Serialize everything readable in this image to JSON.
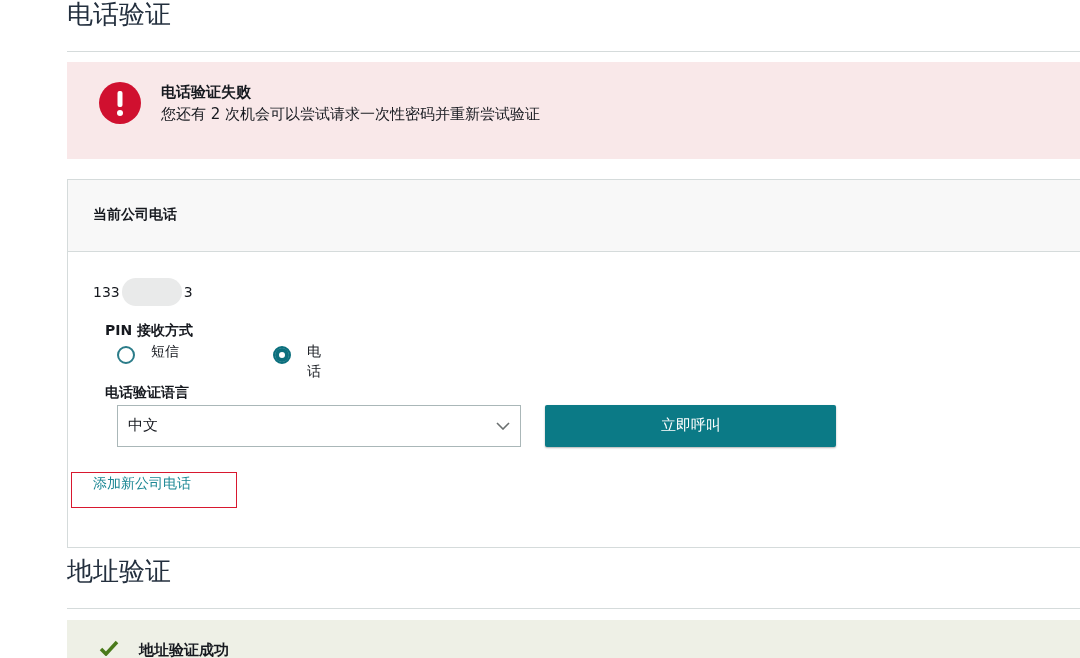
{
  "phone_section": {
    "title": "电话验证",
    "alert": {
      "kind": "error",
      "title": "电话验证失败",
      "message": "您还有 2 次机会可以尝试请求一次性密码并重新尝试验证"
    },
    "card": {
      "header": "当前公司电话",
      "phone": {
        "start": "133",
        "end": "3",
        "masked": true
      },
      "pin_method": {
        "label": "PIN 接收方式",
        "options": [
          {
            "label": "短信",
            "selected": false
          },
          {
            "label": "电话",
            "selected": true
          }
        ]
      },
      "language": {
        "label": "电话验证语言",
        "value": "中文"
      },
      "call_button": "立即呼叫",
      "add_link": {
        "label": "添加新公司电话",
        "highlighted": true
      }
    }
  },
  "address_section": {
    "title": "地址验证",
    "alert": {
      "kind": "success",
      "title": "地址验证成功"
    }
  }
}
